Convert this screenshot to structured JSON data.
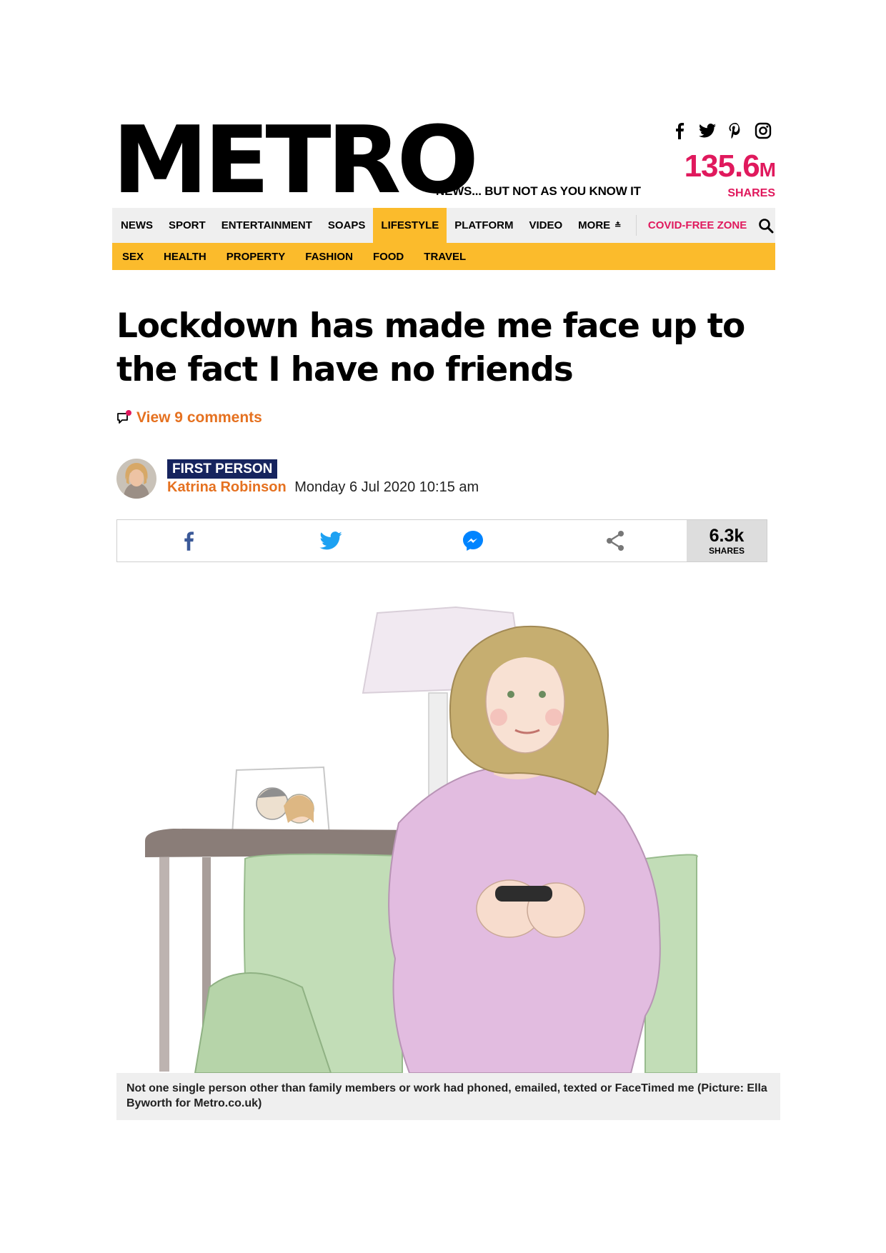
{
  "masthead": {
    "logo": "METRO",
    "tagline": "NEWS... BUT NOT AS YOU KNOW IT",
    "social_icons": [
      "facebook-icon",
      "twitter-icon",
      "pinterest-icon",
      "instagram-icon"
    ],
    "shares_value": "135.6",
    "shares_unit": "M",
    "shares_label": "SHARES"
  },
  "nav": {
    "items": [
      "NEWS",
      "SPORT",
      "ENTERTAINMENT",
      "SOAPS",
      "LIFESTYLE",
      "PLATFORM",
      "VIDEO",
      "MORE"
    ],
    "active": "LIFESTYLE",
    "covid": "COVID-FREE ZONE",
    "search_icon": "search-icon"
  },
  "subnav": {
    "items": [
      "SEX",
      "HEALTH",
      "PROPERTY",
      "FASHION",
      "FOOD",
      "TRAVEL"
    ]
  },
  "article": {
    "headline": "Lockdown has made me face up to the fact I have no friends",
    "comments_link": "View 9 comments",
    "badge": "FIRST PERSON",
    "author": "Katrina Robinson",
    "date": "Monday 6 Jul 2020 10:15 am",
    "share_count": "6.3k",
    "share_label": "SHARES",
    "caption": "Not one single person other than family members or work had phoned, emailed, texted or FaceTimed me (Picture: Ella Byworth for Metro.co.uk)"
  },
  "colors": {
    "accent_pink": "#e0195d",
    "nav_yellow": "#fbbb2c",
    "link_orange": "#e57120",
    "badge_navy": "#16245e",
    "facebook": "#3b5998",
    "twitter": "#1da1f2",
    "messenger": "#0084ff"
  }
}
